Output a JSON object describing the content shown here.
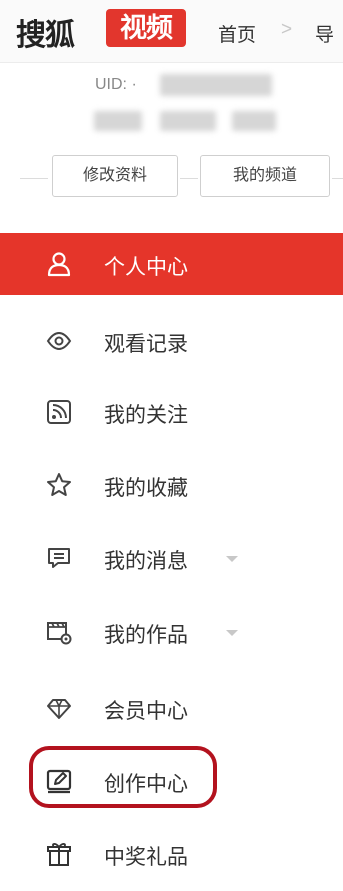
{
  "header": {
    "logo_text": "搜狐",
    "logo_badge": "视频",
    "nav_home": "首页",
    "nav_separator": ">",
    "nav_next": "导"
  },
  "profile": {
    "uid_label": "UID: ·",
    "edit_profile_button": "修改资料",
    "my_channel_button": "我的频道"
  },
  "menu": {
    "items": [
      {
        "label": "个人中心",
        "icon": "user-icon",
        "active": true
      },
      {
        "label": "观看记录",
        "icon": "eye-icon"
      },
      {
        "label": "我的关注",
        "icon": "rss-icon"
      },
      {
        "label": "我的收藏",
        "icon": "star-icon"
      },
      {
        "label": "我的消息",
        "icon": "message-icon",
        "has_dropdown": true
      },
      {
        "label": "我的作品",
        "icon": "clapper-gear-icon",
        "has_dropdown": true
      },
      {
        "label": "会员中心",
        "icon": "diamond-icon"
      },
      {
        "label": "创作中心",
        "icon": "edit-icon",
        "highlighted": true
      },
      {
        "label": "中奖礼品",
        "icon": "gift-icon"
      }
    ]
  },
  "colors": {
    "brand_red": "#e2362d",
    "active_bg": "#e5352a",
    "highlight_ring": "#b3121e"
  }
}
